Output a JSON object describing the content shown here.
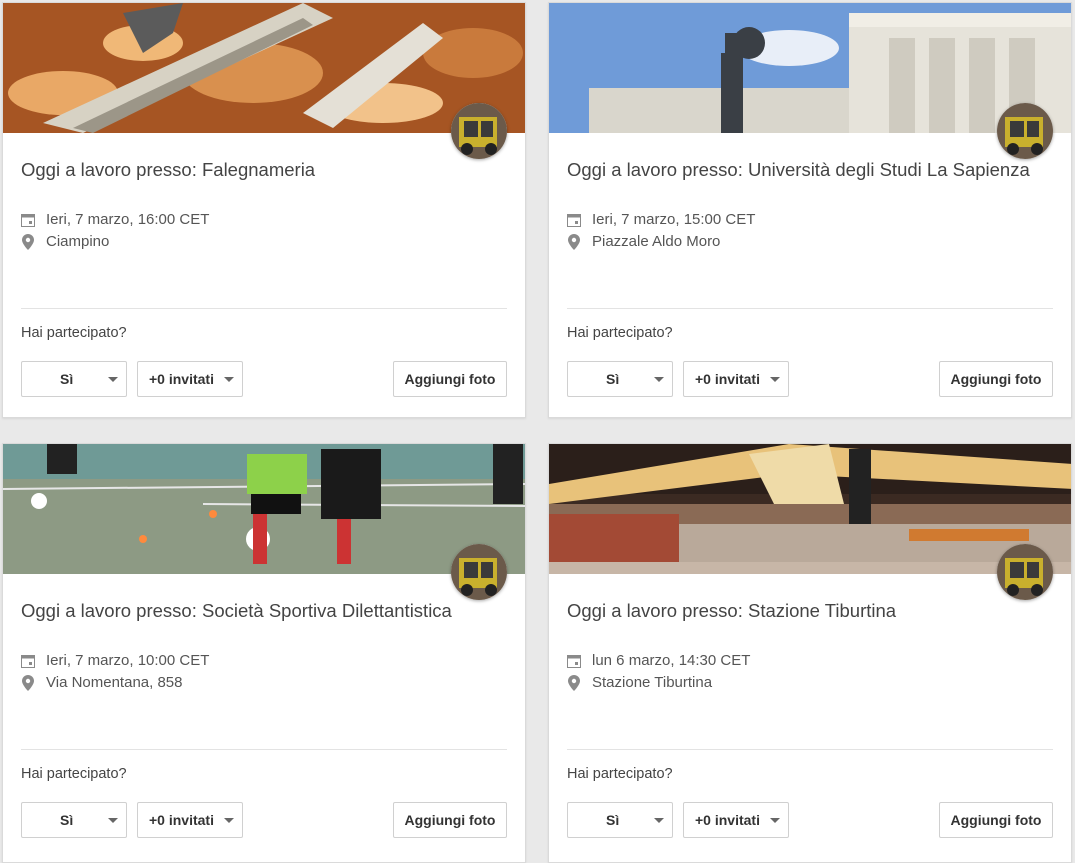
{
  "cards": [
    {
      "title": "Oggi a lavoro presso: Falegnameria",
      "date": "Ieri, 7 marzo, 16:00 CET",
      "location": "Ciampino",
      "question": "Hai partecipato?",
      "rsvp_value": "Sì",
      "guests_label": "+0 invitati",
      "add_photo_label": "Aggiungi foto"
    },
    {
      "title": "Oggi a lavoro presso: Università degli Studi La Sapienza",
      "date": "Ieri, 7 marzo, 15:00 CET",
      "location": "Piazzale Aldo Moro",
      "question": "Hai partecipato?",
      "rsvp_value": "Sì",
      "guests_label": "+0 invitati",
      "add_photo_label": "Aggiungi foto"
    },
    {
      "title": "Oggi a lavoro presso: Società Sportiva Dilettantistica",
      "date": "Ieri, 7 marzo, 10:00 CET",
      "location": "Via Nomentana, 858",
      "question": "Hai partecipato?",
      "rsvp_value": "Sì",
      "guests_label": "+0 invitati",
      "add_photo_label": "Aggiungi foto"
    },
    {
      "title": "Oggi a lavoro presso: Stazione Tiburtina",
      "date": "lun 6 marzo, 14:30 CET",
      "location": "Stazione Tiburtina",
      "question": "Hai partecipato?",
      "rsvp_value": "Sì",
      "guests_label": "+0 invitati",
      "add_photo_label": "Aggiungi foto"
    }
  ],
  "icons": {
    "date": "calendar-icon",
    "location": "map-pin-icon",
    "dropdown": "caret-down-icon"
  },
  "colors": {
    "background": "#e9e9e9",
    "card": "#ffffff",
    "title_text": "#444444",
    "icon": "#8a8a8a"
  }
}
